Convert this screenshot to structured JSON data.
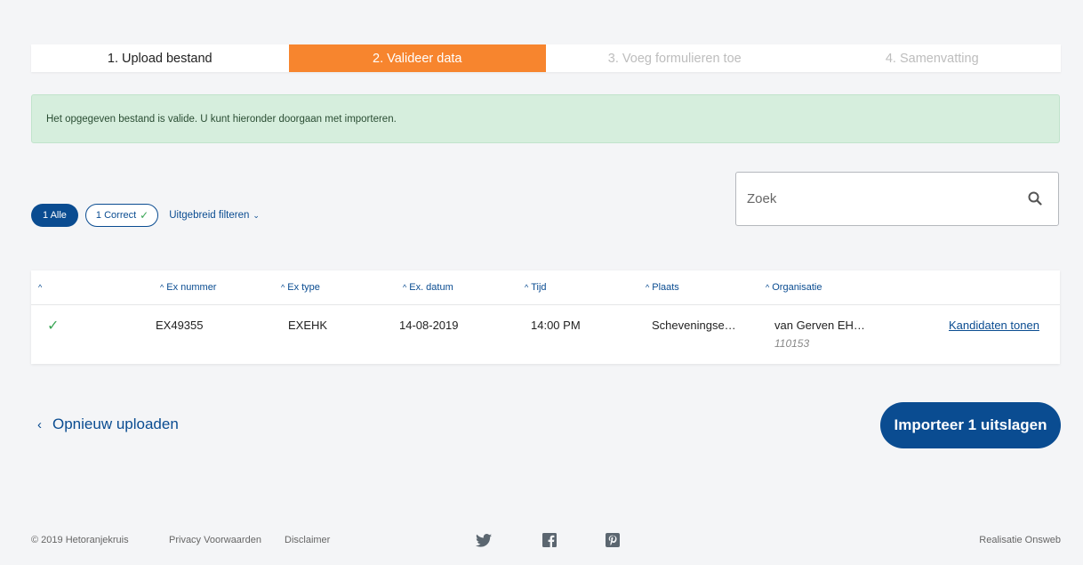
{
  "steps": [
    {
      "label": "1. Upload bestand",
      "state": "done"
    },
    {
      "label": "2. Valideer data",
      "state": "active"
    },
    {
      "label": "3. Voeg formulieren toe",
      "state": "pending"
    },
    {
      "label": "4. Samenvatting",
      "state": "pending"
    }
  ],
  "alert": {
    "text": "Het opgegeven bestand is valide. U kunt hieronder doorgaan met importeren."
  },
  "filters": {
    "all_label": "1 Alle",
    "correct_label": "1 Correct",
    "advanced_label": "Uitgebreid filteren"
  },
  "search": {
    "placeholder": "Zoek"
  },
  "table": {
    "columns": [
      {
        "label": ""
      },
      {
        "label": "Ex nummer"
      },
      {
        "label": "Ex type"
      },
      {
        "label": "Ex. datum"
      },
      {
        "label": "Tijd"
      },
      {
        "label": "Plaats"
      },
      {
        "label": "Organisatie"
      }
    ],
    "rows": [
      {
        "status_icon": "check-icon",
        "ex_nummer": "EX49355",
        "ex_type": "EXEHK",
        "ex_datum": "14-08-2019",
        "tijd": "14:00 PM",
        "plaats": "Scheveningse…",
        "organisatie": "van Gerven EH…",
        "organisatie_id": "110153",
        "action_label": "Kandidaten tonen"
      }
    ]
  },
  "actions": {
    "back_label": "Opnieuw uploaden",
    "import_label": "Importeer 1 uitslagen"
  },
  "footer": {
    "copyright": "© 2019 Hetoranjekruis",
    "privacy": "Privacy Voorwaarden",
    "disclaimer": "Disclaimer",
    "social_icons": [
      "twitter-icon",
      "facebook-icon",
      "pinterest-icon"
    ],
    "credit": "Realisatie Onsweb"
  },
  "colors": {
    "accent_orange": "#f7852e",
    "primary_blue": "#0a4c91",
    "success_green": "#3aa655",
    "alert_bg": "#d6eedd"
  }
}
